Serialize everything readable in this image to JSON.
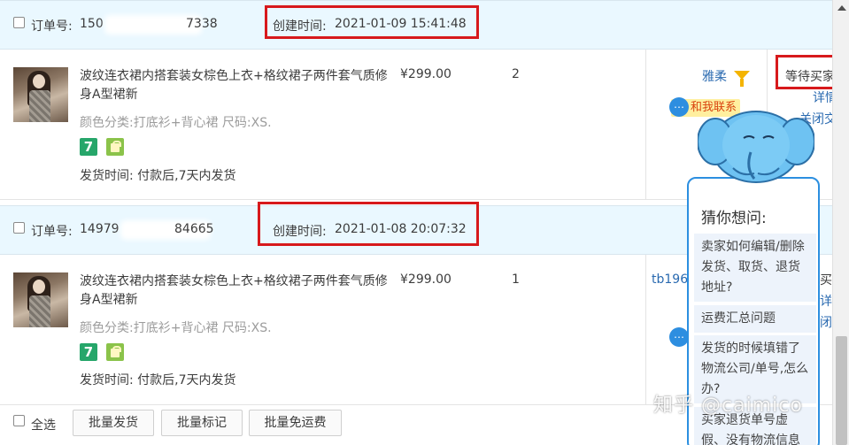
{
  "orders": [
    {
      "order_label": "订单号:",
      "order_no_start": "150",
      "order_no_end": "7338",
      "created_label": "创建时间:",
      "created_time": "2021-01-09 15:41:48",
      "title": "波纹连衣裙内搭套装女棕色上衣+格纹裙子两件套气质修身A型裙新",
      "spec": "颜色分类:打底衫+背心裙 尺码:XS.",
      "ship_label": "发货时间:",
      "ship_value": "付款后,7天内发货",
      "price": "¥299.00",
      "qty": "2",
      "buyer": "雅柔",
      "contact": "和我联系",
      "status": "等待买家",
      "detail": "详情",
      "close": "关闭交"
    },
    {
      "order_label": "订单号:",
      "order_no_start": "14979",
      "order_no_end": "84665",
      "created_label": "创建时间:",
      "created_time": "2021-01-08 20:07:32",
      "title": "波纹连衣裙内搭套装女棕色上衣+格纹裙子两件套气质修身A型裙新",
      "spec": "颜色分类:打底衫+背心裙 尺码:XS.",
      "ship_label": "发货时间:",
      "ship_value": "付款后,7天内发货",
      "price": "¥299.00",
      "qty": "1",
      "buyer": "tb196",
      "status": "买",
      "detail": "详",
      "close": "闭"
    }
  ],
  "badges": {
    "seven": "7"
  },
  "footer": {
    "select_all": "全选",
    "buttons": [
      "批量发货",
      "批量标记",
      "批量免运费"
    ]
  },
  "assistant": {
    "title": "猜你想问:",
    "questions": [
      "卖家如何编辑/删除发货、取货、退货地址?",
      "运费汇总问题",
      "发货的时候填错了物流公司/单号,怎么办?",
      "买家退货单号虚假、没有物流信息"
    ]
  },
  "watermark": "知乎 @caimico",
  "colors": {
    "highlight_border": "#d7191c",
    "header_bg": "#eaf8ff",
    "link": "#2a6ab0",
    "popup_border": "#2c8fe0"
  }
}
